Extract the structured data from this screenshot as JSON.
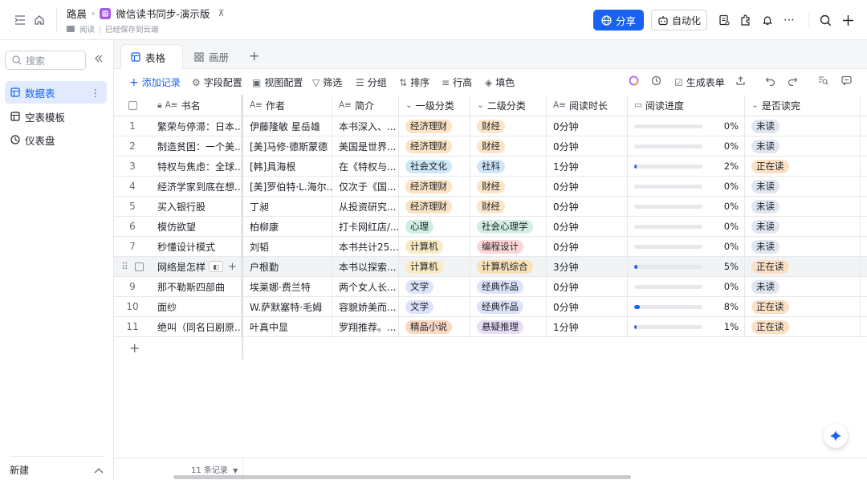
{
  "topbar": {
    "breadcrumb_parent": "路晨",
    "doc_title": "微信读书同步-演示版",
    "folder": "阅读",
    "save_status": "已经保存到云端",
    "share_label": "分享",
    "automation_label": "自动化"
  },
  "sidebar": {
    "search_placeholder": "搜索",
    "items": [
      {
        "label": "数据表"
      },
      {
        "label": "空表模板"
      },
      {
        "label": "仪表盘"
      }
    ],
    "new_label": "新建"
  },
  "view_tabs": [
    {
      "label": "表格"
    },
    {
      "label": "画册"
    }
  ],
  "toolbar": {
    "add_record": "添加记录",
    "field_config": "字段配置",
    "view_config": "视图配置",
    "filter": "筛选",
    "group": "分组",
    "sort": "排序",
    "row_height": "行高",
    "fill_color": "填色",
    "generate_form": "生成表单"
  },
  "table": {
    "columns": [
      "书名",
      "作者",
      "简介",
      "一级分类",
      "二级分类",
      "阅读时长",
      "阅读进度",
      "是否读完"
    ],
    "rows": [
      {
        "num": "1",
        "title": "繁荣与停滞：日本...",
        "author": "伊藤隆敏 星岳雄",
        "intro": "本书深入、...",
        "cat1": "经济理财",
        "cat2": "财经",
        "duration": "0分钟",
        "progress": 0,
        "progress_label": "0%",
        "status": "未读"
      },
      {
        "num": "2",
        "title": "制造贫困：一个美...",
        "author": "[美]马修·德斯蒙德",
        "intro": "美国是世界...",
        "cat1": "经济理财",
        "cat2": "财经",
        "duration": "0分钟",
        "progress": 0,
        "progress_label": "0%",
        "status": "未读"
      },
      {
        "num": "3",
        "title": "特权与焦虑：全球...",
        "author": "[韩]具海根",
        "intro": "在《特权与...",
        "cat1": "社会文化",
        "cat2": "社科",
        "duration": "1分钟",
        "progress": 2,
        "progress_label": "2%",
        "status": "正在读"
      },
      {
        "num": "4",
        "title": "经济学家到底在想...",
        "author": "[美]罗伯特·L.海尔...",
        "intro": "仅次于《国...",
        "cat1": "经济理财",
        "cat2": "财经",
        "duration": "0分钟",
        "progress": 0,
        "progress_label": "0%",
        "status": "未读"
      },
      {
        "num": "5",
        "title": "买入银行股",
        "author": "丁昶",
        "intro": "从投资研究...",
        "cat1": "经济理财",
        "cat2": "财经",
        "duration": "0分钟",
        "progress": 0,
        "progress_label": "0%",
        "status": "未读"
      },
      {
        "num": "6",
        "title": "模仿欲望",
        "author": "柏柳康",
        "intro": "打卡网红店/...",
        "cat1": "心理",
        "cat2": "社会心理学",
        "duration": "0分钟",
        "progress": 0,
        "progress_label": "0%",
        "status": "未读"
      },
      {
        "num": "7",
        "title": "秒懂设计模式",
        "author": "刘韬",
        "intro": "本书共计25...",
        "cat1": "计算机",
        "cat2": "编程设计",
        "duration": "0分钟",
        "progress": 0,
        "progress_label": "0%",
        "status": "未读"
      },
      {
        "num": "",
        "title": "网络是怎样",
        "author": "户根勤",
        "intro": "本书以探索...",
        "cat1": "计算机",
        "cat2": "计算机综合",
        "duration": "3分钟",
        "progress": 5,
        "progress_label": "5%",
        "status": "正在读"
      },
      {
        "num": "9",
        "title": "那不勒斯四部曲",
        "author": "埃莱娜·费兰特",
        "intro": "两个女人长...",
        "cat1": "文学",
        "cat2": "经典作品",
        "duration": "0分钟",
        "progress": 0,
        "progress_label": "0%",
        "status": "未读"
      },
      {
        "num": "10",
        "title": "面纱",
        "author": "W.萨默塞特·毛姆",
        "intro": "容貌娇美而...",
        "cat1": "文学",
        "cat2": "经典作品",
        "duration": "0分钟",
        "progress": 8,
        "progress_label": "8%",
        "status": "正在读"
      },
      {
        "num": "11",
        "title": "绝叫（同名日剧原...",
        "author": "叶真中显",
        "intro": "罗翔推荐。...",
        "cat1": "精品小说",
        "cat2": "悬疑推理",
        "duration": "1分钟",
        "progress": 1,
        "progress_label": "1%",
        "status": "正在读"
      }
    ]
  },
  "tag_colors": {
    "经济理财": {
      "bg": "#fbe3c4",
      "fg": "#1f2329"
    },
    "社会文化": {
      "bg": "#cde7f7",
      "fg": "#1f2329"
    },
    "心理": {
      "bg": "#cdeee0",
      "fg": "#1f2329"
    },
    "计算机": {
      "bg": "#faeac2",
      "fg": "#1f2329"
    },
    "文学": {
      "bg": "#dde3fb",
      "fg": "#1f2329"
    },
    "精品小说": {
      "bg": "#fbd8c4",
      "fg": "#1f2329"
    },
    "财经": {
      "bg": "#fce4c8",
      "fg": "#1f2329"
    },
    "社科": {
      "bg": "#cfe5fa",
      "fg": "#1f2329"
    },
    "社会心理学": {
      "bg": "#d3efe3",
      "fg": "#1f2329"
    },
    "编程设计": {
      "bg": "#fbd6d6",
      "fg": "#1f2329"
    },
    "计算机综合": {
      "bg": "#f7e2b8",
      "fg": "#1f2329"
    },
    "经典作品": {
      "bg": "#dde3fb",
      "fg": "#1f2329"
    },
    "悬疑推理": {
      "bg": "#e8ddf7",
      "fg": "#1f2329"
    },
    "未读": {
      "bg": "#dfe6f0",
      "fg": "#1f2329"
    },
    "正在读": {
      "bg": "#fbe0c4",
      "fg": "#1f2329"
    }
  },
  "footer": {
    "record_count": "11 条记录"
  },
  "accent_color": "#1a62f2"
}
